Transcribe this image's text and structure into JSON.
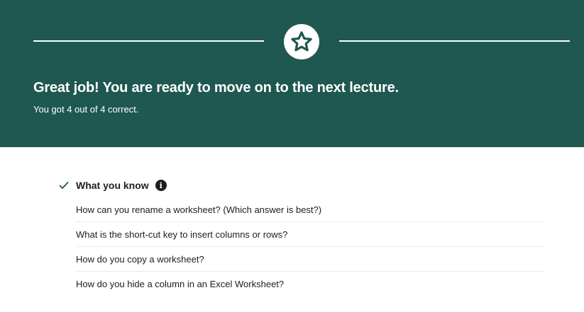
{
  "banner": {
    "title": "Great job! You are ready to move on to the next lecture.",
    "subtitle": "You got 4 out of 4 correct.",
    "background_color": "#1e5850",
    "badge_icon": "star-icon"
  },
  "section": {
    "title": "What you know",
    "status_icon": "check-icon",
    "info_icon": "info-icon",
    "check_color": "#1e5850"
  },
  "questions": [
    "How can you rename a worksheet? (Which answer is best?)",
    "What is the short-cut key to insert columns or rows?",
    "How do you copy a worksheet?",
    "How do you hide a column in an Excel Worksheet?"
  ]
}
